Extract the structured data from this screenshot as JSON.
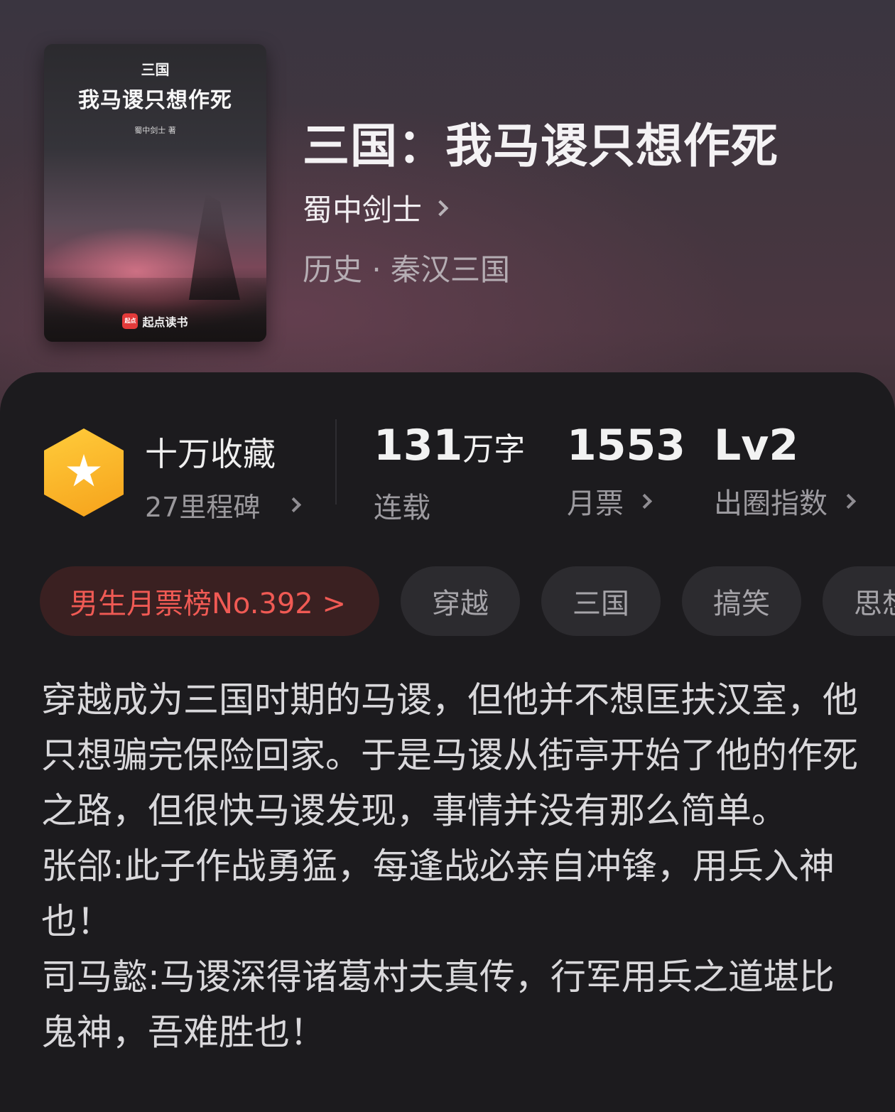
{
  "book": {
    "title": "三国：我马谡只想作死",
    "author": "蜀中剑士",
    "category": "历史 · 秦汉三国"
  },
  "cover": {
    "series": "三国",
    "title": "我马谡只想作死",
    "author": "蜀中剑士 著",
    "publisher": "起点读书",
    "publisher_logo": "起点"
  },
  "milestone": {
    "title": "十万收藏",
    "subtitle": "27里程碑",
    "icon": "star-hexagon-icon"
  },
  "stats": {
    "words": {
      "value": "131",
      "unit": "万字",
      "label": "连载"
    },
    "tickets": {
      "value": "1553",
      "label": "月票"
    },
    "level": {
      "value": "Lv2",
      "label": "出圈指数"
    }
  },
  "tags": {
    "rank": "男生月票榜No.392 >",
    "items": [
      "穿越",
      "三国",
      "搞笑",
      "思想"
    ]
  },
  "synopsis": {
    "paragraphs": [
      "穿越成为三国时期的马谡，但他并不想匡扶汉室，他只想骗完保险回家。于是马谡从街亭开始了他的作死之路，但很快马谡发现，事情并没有那么简单。",
      "张郃:此子作战勇猛，每逢战必亲自冲锋，用兵入神也！",
      "司马懿:马谡深得诸葛村夫真传，行军用兵之道堪比鬼神，吾难胜也！"
    ]
  },
  "colors": {
    "accent_red": "#f05a54",
    "rank_bg": "#3a2021",
    "milestone_gold": "#f8b52a"
  }
}
